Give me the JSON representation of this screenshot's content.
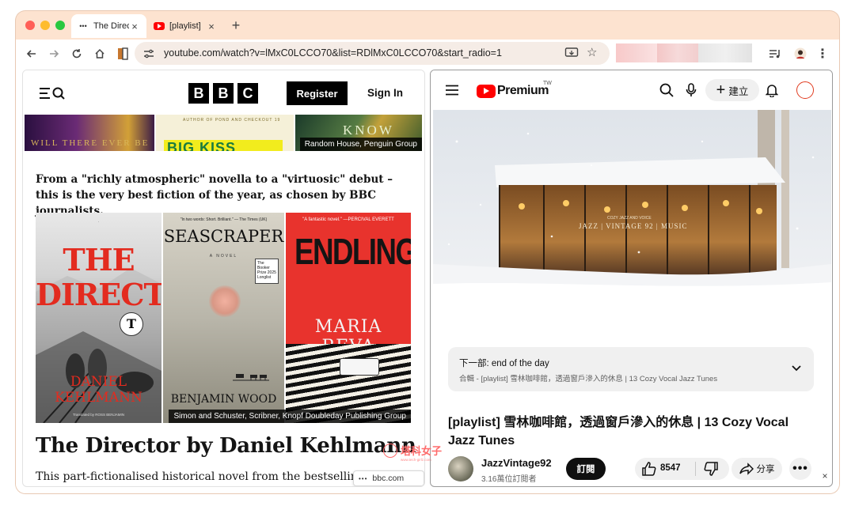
{
  "browser": {
    "tabs": [
      {
        "title": "The Direc",
        "icon": "dots-icon",
        "active": true
      },
      {
        "title": "[playlist]",
        "icon": "youtube-icon",
        "active": false
      }
    ],
    "new_tab_label": "+",
    "url": "youtube.com/watch?v=lMxC0LCCO70&list=RDlMxC0LCCO70&start_radio=1",
    "close_label": "×"
  },
  "bbc": {
    "logo_letters": [
      "B",
      "B",
      "C"
    ],
    "register_label": "Register",
    "signin_label": "Sign In",
    "strip_books": {
      "book1_text": "WILL THERE EVER BE",
      "book2_small": "AUTHOR OF POND AND CHECKOUT 19",
      "book2_big": "BIG KISS",
      "book3_text": "KNOW"
    },
    "top_credit": "Random House, Penguin Group",
    "intro": "From a \"richly atmospheric\" novella to a \"virtuosic\" debut – this is the very best fiction of the year, as chosen by BBC journalists.",
    "covers": {
      "director": {
        "title_line1": "THE",
        "title_line2": "DIRECTOR",
        "author": "DANIEL KEHLMANN",
        "translator": "Translated by ROSS BENJAMIN"
      },
      "seascraper": {
        "quote": "\"In two words: Short. Brilliant.\" — The Times (UK)",
        "title": "SEASCRAPER",
        "tag": "A NOVEL",
        "booker": "The Booker Prize 2025 Longlist",
        "author": "BENJAMIN WOOD"
      },
      "endling": {
        "quote": "\"A fantastic novel.\" —PERCIVAL EVERETT",
        "title": "ENDLING",
        "author": "MARIA REVA"
      }
    },
    "covers_credit": "Simon and Schuster, Scribner, Knopf Doubleday Publishing Group",
    "heading": "The Director by Daniel Kehlmann",
    "body_start": "This part-fictionalised historical novel from the bestselling",
    "hover_url": "bbc.com"
  },
  "youtube": {
    "brand": "Premium",
    "region": "TW",
    "create_label": "建立",
    "video_overlay_small": "COZY JAZZ AND VOICE",
    "video_overlay": "JAZZ | VINTAGE 92 | MUSIC",
    "up_next_title": "下一部: end of the day",
    "up_next_sub": "合輯 - [playlist] 雪林咖啡館，透過窗戶滲入的休息 | 13 Cozy Vocal Jazz Tunes",
    "title": "[playlist] 雪林咖啡館，透過窗戶滲入的休息 | 13 Cozy Vocal Jazz Tunes",
    "channel_name": "JazzVintage92",
    "subscribers": "3.16萬位訂閱者",
    "subscribe_label": "訂閱",
    "likes": "8547",
    "share_label": "分享",
    "more_label": "•••"
  },
  "watermark": {
    "text": "塔科女子",
    "sub": "www.tech-girlz.com"
  },
  "colors": {
    "frame": "#fde3d0",
    "yt_red": "#ff0000",
    "bbc_black": "#000000",
    "watermark": "#ff6b6b"
  }
}
